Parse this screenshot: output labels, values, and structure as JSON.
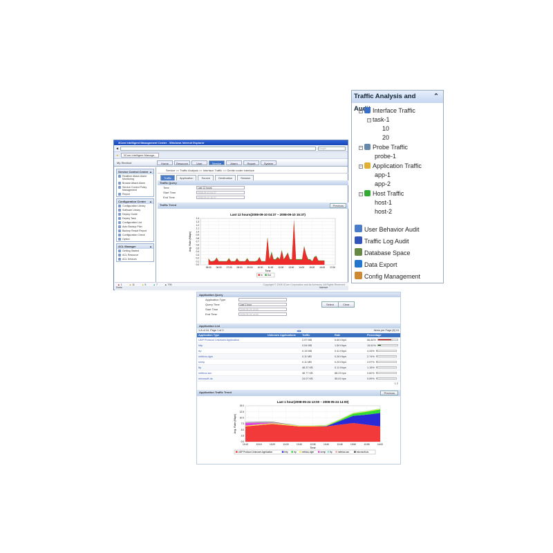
{
  "browser": {
    "title": "3Com Intelligent Management Center - Windows Internet Explorer",
    "tab": "3Com Intelligent Manage...",
    "search_placeholder": "Google",
    "status_done": "Done",
    "status_zone": "Internet",
    "zoom": "100%"
  },
  "app": {
    "shortcut": "My Shortcut",
    "nav": [
      "Home",
      "Resource",
      "User",
      "Service",
      "Alarm",
      "Report",
      "System"
    ],
    "nav_active": 3,
    "breadcrumb": "Service >> Traffic Analysis >> Interface Traffic >> Gentle router interface",
    "tabs": [
      "Traffic",
      "Application",
      "Source",
      "Destination",
      "Session"
    ],
    "tab_active": 0,
    "sidebar": [
      {
        "title": "Service Control Center",
        "items": [
          "Realtime Attack Alarm Monitoring",
          "Browse Attack Alarm",
          "Service Control Policy Management",
          "Report"
        ]
      },
      {
        "title": "Configuration Center",
        "items": [
          "Configuration Library",
          "Software Library",
          "Deploy Guide",
          "Deploy Task",
          "Configuration List",
          "Auto Backup Plan",
          "Backup Result Report",
          "Configuration Check",
          "Option"
        ]
      },
      {
        "title": "ACL Manager",
        "items": [
          "Getting Started",
          "ACL Resource",
          "ACL Devices"
        ]
      }
    ],
    "query": {
      "title": "Traffic Query",
      "time_label": "Time",
      "time_value": "Last 12 hours",
      "start_label": "Start Time",
      "start_value": "2008-09-10 04:37",
      "end_label": "End Time",
      "end_value": "2008-09-10 16:37"
    },
    "trend": {
      "title": "Traffic Trend",
      "previous": "Previous"
    },
    "alarms": [
      {
        "color": "#cc0000",
        "count": "1"
      },
      {
        "color": "#e09000",
        "count": "11"
      },
      {
        "color": "#c8c800",
        "count": "5"
      },
      {
        "color": "#20a080",
        "count": "7"
      },
      {
        "color": "#444466",
        "count": "795"
      }
    ],
    "copyright": "Copyright © 2008 3Com Corporation and its licensors. All Rights Reserved."
  },
  "tree": {
    "title": "Traffic Analysis and Audit",
    "nodes": [
      {
        "label": "Interface Traffic",
        "icon": "interface-icon",
        "children": [
          {
            "label": "task-1",
            "children": [
              "10",
              "20"
            ]
          }
        ]
      },
      {
        "label": "Probe Traffic",
        "icon": "probe-icon",
        "children": [
          "probe-1"
        ]
      },
      {
        "label": "Application Traffic",
        "icon": "application-icon",
        "children": [
          "app-1",
          "app-2"
        ]
      },
      {
        "label": "Host Traffic",
        "icon": "host-icon",
        "children": [
          "host-1",
          "host-2"
        ]
      }
    ],
    "links": [
      {
        "label": "User Behavior Audit",
        "icon": "user-audit-icon"
      },
      {
        "label": "Traffic Log Audit",
        "icon": "log-audit-icon"
      },
      {
        "label": "Database Space",
        "icon": "database-icon"
      },
      {
        "label": "Data Export",
        "icon": "export-icon"
      },
      {
        "label": "Config Management",
        "icon": "config-icon"
      }
    ]
  },
  "appquery": {
    "title": "Application Query",
    "type_label": "Application Type",
    "type_value": "",
    "qtime_label": "Query Time",
    "qtime_value": "Last 1 hour",
    "start_label": "Start Time",
    "start_value": "2008-05-24 13:00",
    "end_label": "End Time",
    "end_value": "2008-05-24 14:00",
    "select": "Select",
    "clear": "Clear"
  },
  "applist": {
    "title": "Application List",
    "paging": "1-8 of 16. Page 1 of 2.",
    "per_page": "Items per Page [8] 15",
    "pages": "1 2",
    "columns": [
      "Application Type",
      "Unknown Applications",
      "Traffic",
      "Rate",
      "Percentage"
    ],
    "rows": [
      {
        "type": "UDP Protocol Unknown Application",
        "unknown": "",
        "traffic": "2.97 MB",
        "rate": "6.66 Kbps",
        "pct": "66.84%",
        "val": 66.84,
        "color": "#cc0000"
      },
      {
        "type": "http",
        "unknown": "",
        "traffic": "0.54 MB",
        "rate": "1.50 Kbps",
        "pct": "15.61%",
        "val": 15.61,
        "color": "#006600"
      },
      {
        "type": "rtp",
        "unknown": "",
        "traffic": "0.19 MB",
        "rate": "0.41 Kbps",
        "pct": "4.33%",
        "val": 4.33,
        "color": "#888"
      },
      {
        "type": "netbios-dgm",
        "unknown": "",
        "traffic": "0.11 MB",
        "rate": "0.26 Kbps",
        "pct": "2.74%",
        "val": 2.74,
        "color": "#888"
      },
      {
        "type": "snmp",
        "unknown": "",
        "traffic": "0.11 MB",
        "rate": "0.25 Kbps",
        "pct": "2.57%",
        "val": 2.57,
        "color": "#888"
      },
      {
        "type": "ftp",
        "unknown": "",
        "traffic": "48.37 KB",
        "rate": "0.11 Kbps",
        "pct": "1.15%",
        "val": 1.15,
        "color": "#888"
      },
      {
        "type": "netbios-ssn",
        "unknown": "",
        "traffic": "38.77 KB",
        "rate": "88.23 bps",
        "pct": "0.82%",
        "val": 0.82,
        "color": "#888"
      },
      {
        "type": "microsoft-ds",
        "unknown": "",
        "traffic": "24.07 KB",
        "rate": "55.02 bps",
        "pct": "0.59%",
        "val": 0.59,
        "color": "#888"
      }
    ]
  },
  "apptrend": {
    "title": "Application Traffic Trend",
    "previous": "Previous"
  },
  "chart_data": [
    {
      "type": "area",
      "title": "Last 12 hours(2008-09-10 04:37 – 2008-09-10 16:37)",
      "xlabel": "Time",
      "ylabel": "Avg. Rate (Mbps)",
      "ylim": [
        0,
        1.4
      ],
      "yticks": [
        "0.0",
        "0.1",
        "0.2",
        "0.3",
        "0.4",
        "0.5",
        "0.6",
        "0.7",
        "0.8",
        "0.9",
        "1.0",
        "1.1",
        "1.2",
        "1.3",
        "1.4"
      ],
      "categories": [
        "05:00",
        "06:00",
        "07:00",
        "08:00",
        "09:00",
        "10:00",
        "11:00",
        "12:00",
        "13:00",
        "14:00",
        "15:00",
        "16:00",
        "17:00"
      ],
      "series": [
        {
          "name": "In",
          "color": "#ee2a2a",
          "values": [
            0.18,
            0.1,
            0.1,
            0.12,
            0.2,
            0.1,
            0.1,
            0.1,
            0.1,
            0.1,
            0.18,
            0.1,
            0.1,
            0.1,
            0.18,
            0.1,
            0.1,
            0.1,
            0.1,
            0.18,
            0.1,
            0.1,
            0.1,
            0.1,
            0.12,
            0.22,
            0.1,
            0.1,
            0.1,
            0.82,
            0.15,
            0.35,
            0.15,
            0.15,
            0.22,
            0.15,
            0.42,
            0.15,
            0.25,
            0.35,
            0.15,
            0.15,
            1.35,
            0.15,
            0.15,
            0.15,
            0.15,
            0.55,
            0.3,
            0.15,
            0.15,
            0.1,
            0.22,
            0.25,
            0.12,
            0.12,
            0.12,
            0.12
          ]
        },
        {
          "name": "Out",
          "color": "#33aa33",
          "values": [
            0.19,
            0.11,
            0.11,
            0.13,
            0.22,
            0.11,
            0.11,
            0.11,
            0.11,
            0.11,
            0.2,
            0.11,
            0.11,
            0.11,
            0.2,
            0.11,
            0.11,
            0.11,
            0.11,
            0.2,
            0.11,
            0.11,
            0.11,
            0.11,
            0.13,
            0.24,
            0.11,
            0.11,
            0.11,
            0.84,
            0.17,
            0.4,
            0.17,
            0.17,
            0.24,
            0.17,
            0.45,
            0.17,
            0.27,
            0.37,
            0.17,
            0.17,
            1.37,
            0.17,
            0.17,
            0.17,
            0.17,
            0.57,
            0.32,
            0.17,
            0.17,
            0.11,
            0.24,
            0.27,
            0.13,
            0.13,
            0.13,
            0.13
          ]
        }
      ],
      "legend": "bottom"
    },
    {
      "type": "area",
      "stacked": true,
      "title": "Last 1 hour(2008-05-24 13:00 – 2008-05-24 14:00)",
      "xlabel": "Time",
      "ylabel": "Avg. Rate (Kbps)",
      "ylim": [
        0,
        15
      ],
      "yticks": [
        "0.0",
        "2.5",
        "5.0",
        "7.5",
        "10.0",
        "12.5",
        "15.0"
      ],
      "categories": [
        "13:10",
        "13:15",
        "13:20",
        "13:25",
        "13:30",
        "13:35",
        "13:40",
        "13:45",
        "13:50",
        "13:55",
        "14:00"
      ],
      "series": [
        {
          "name": "UDP Protocol Unknown Application",
          "color": "#f23a3a",
          "values": [
            6.4,
            6.9,
            7.4,
            6.9,
            6.4,
            6.4,
            6.4,
            7.1,
            7.8,
            7.1,
            6.4
          ]
        },
        {
          "name": "http",
          "color": "#2a2ad6",
          "values": [
            0,
            0,
            0,
            0,
            0,
            0,
            0.1,
            1.5,
            3,
            4.2,
            5.6
          ]
        },
        {
          "name": "rtp",
          "color": "#33dd33",
          "values": [
            0,
            0,
            0,
            0,
            0,
            0,
            0.1,
            0.4,
            0.9,
            1.2,
            1.5
          ]
        },
        {
          "name": "netbios-dgm",
          "color": "#eeee44",
          "values": [
            0.3,
            0.3,
            0.3,
            0.3,
            0.3,
            0.3,
            0.3,
            0.3,
            0.3,
            0.3,
            0.3
          ]
        },
        {
          "name": "snmp",
          "color": "#e040e0",
          "values": [
            1.2,
            0.7,
            0.2,
            0,
            0,
            0,
            0,
            0,
            0,
            0,
            0
          ]
        },
        {
          "name": "ftp",
          "color": "#77dddd",
          "values": [
            0.1,
            0.1,
            0.1,
            0.1,
            0.1,
            0.1,
            0.1,
            0.1,
            0.1,
            0.1,
            0.1
          ]
        },
        {
          "name": "netbios-ssn",
          "color": "#f5a0a0",
          "values": [
            0.1,
            0.1,
            0.1,
            0.1,
            0,
            0,
            0,
            0,
            0,
            0,
            0
          ]
        },
        {
          "name": "microsoft-ds",
          "color": "#444444",
          "values": [
            0.1,
            0.2,
            0.2,
            0.1,
            0,
            0,
            0,
            0,
            0,
            0,
            0
          ]
        }
      ],
      "legend": "bottom"
    }
  ]
}
